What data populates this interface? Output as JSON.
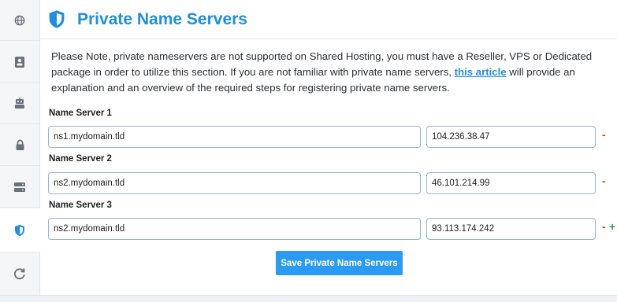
{
  "header": {
    "title": "Private Name Servers"
  },
  "notice": {
    "before_link": "Please Note, private nameservers are not supported on Shared Hosting, you must have a Reseller, VPS or Dedicated package in order to utilize this section. If you are not familiar with private name servers, ",
    "link_text": "this article",
    "after_link": " will provide an explanation and an overview of the required steps for registering private name servers."
  },
  "nameservers": [
    {
      "label": "Name Server 1",
      "hostname": "ns1.mydomain.tld",
      "ip": "104.236.38.47"
    },
    {
      "label": "Name Server 2",
      "hostname": "ns2.mydomain.tld",
      "ip": "46.101.214.99"
    },
    {
      "label": "Name Server 3",
      "hostname": "ns2.mydomain.tld",
      "ip": "93.113.174.242"
    }
  ],
  "controls": {
    "remove_symbol": "-",
    "add_symbol": "+"
  },
  "save_button_label": "Save Private Name Servers",
  "sidebar": {
    "items": [
      {
        "icon": "globe-icon"
      },
      {
        "icon": "contact-card-icon"
      },
      {
        "icon": "robot-icon"
      },
      {
        "icon": "lock-icon"
      },
      {
        "icon": "server-icon"
      },
      {
        "icon": "shield-icon",
        "active": true
      },
      {
        "icon": "refresh-icon"
      }
    ]
  },
  "colors": {
    "accent": "#1d8fe0",
    "button": "#2a9af2",
    "remove": "#e0352b",
    "add": "#2f9e44"
  }
}
